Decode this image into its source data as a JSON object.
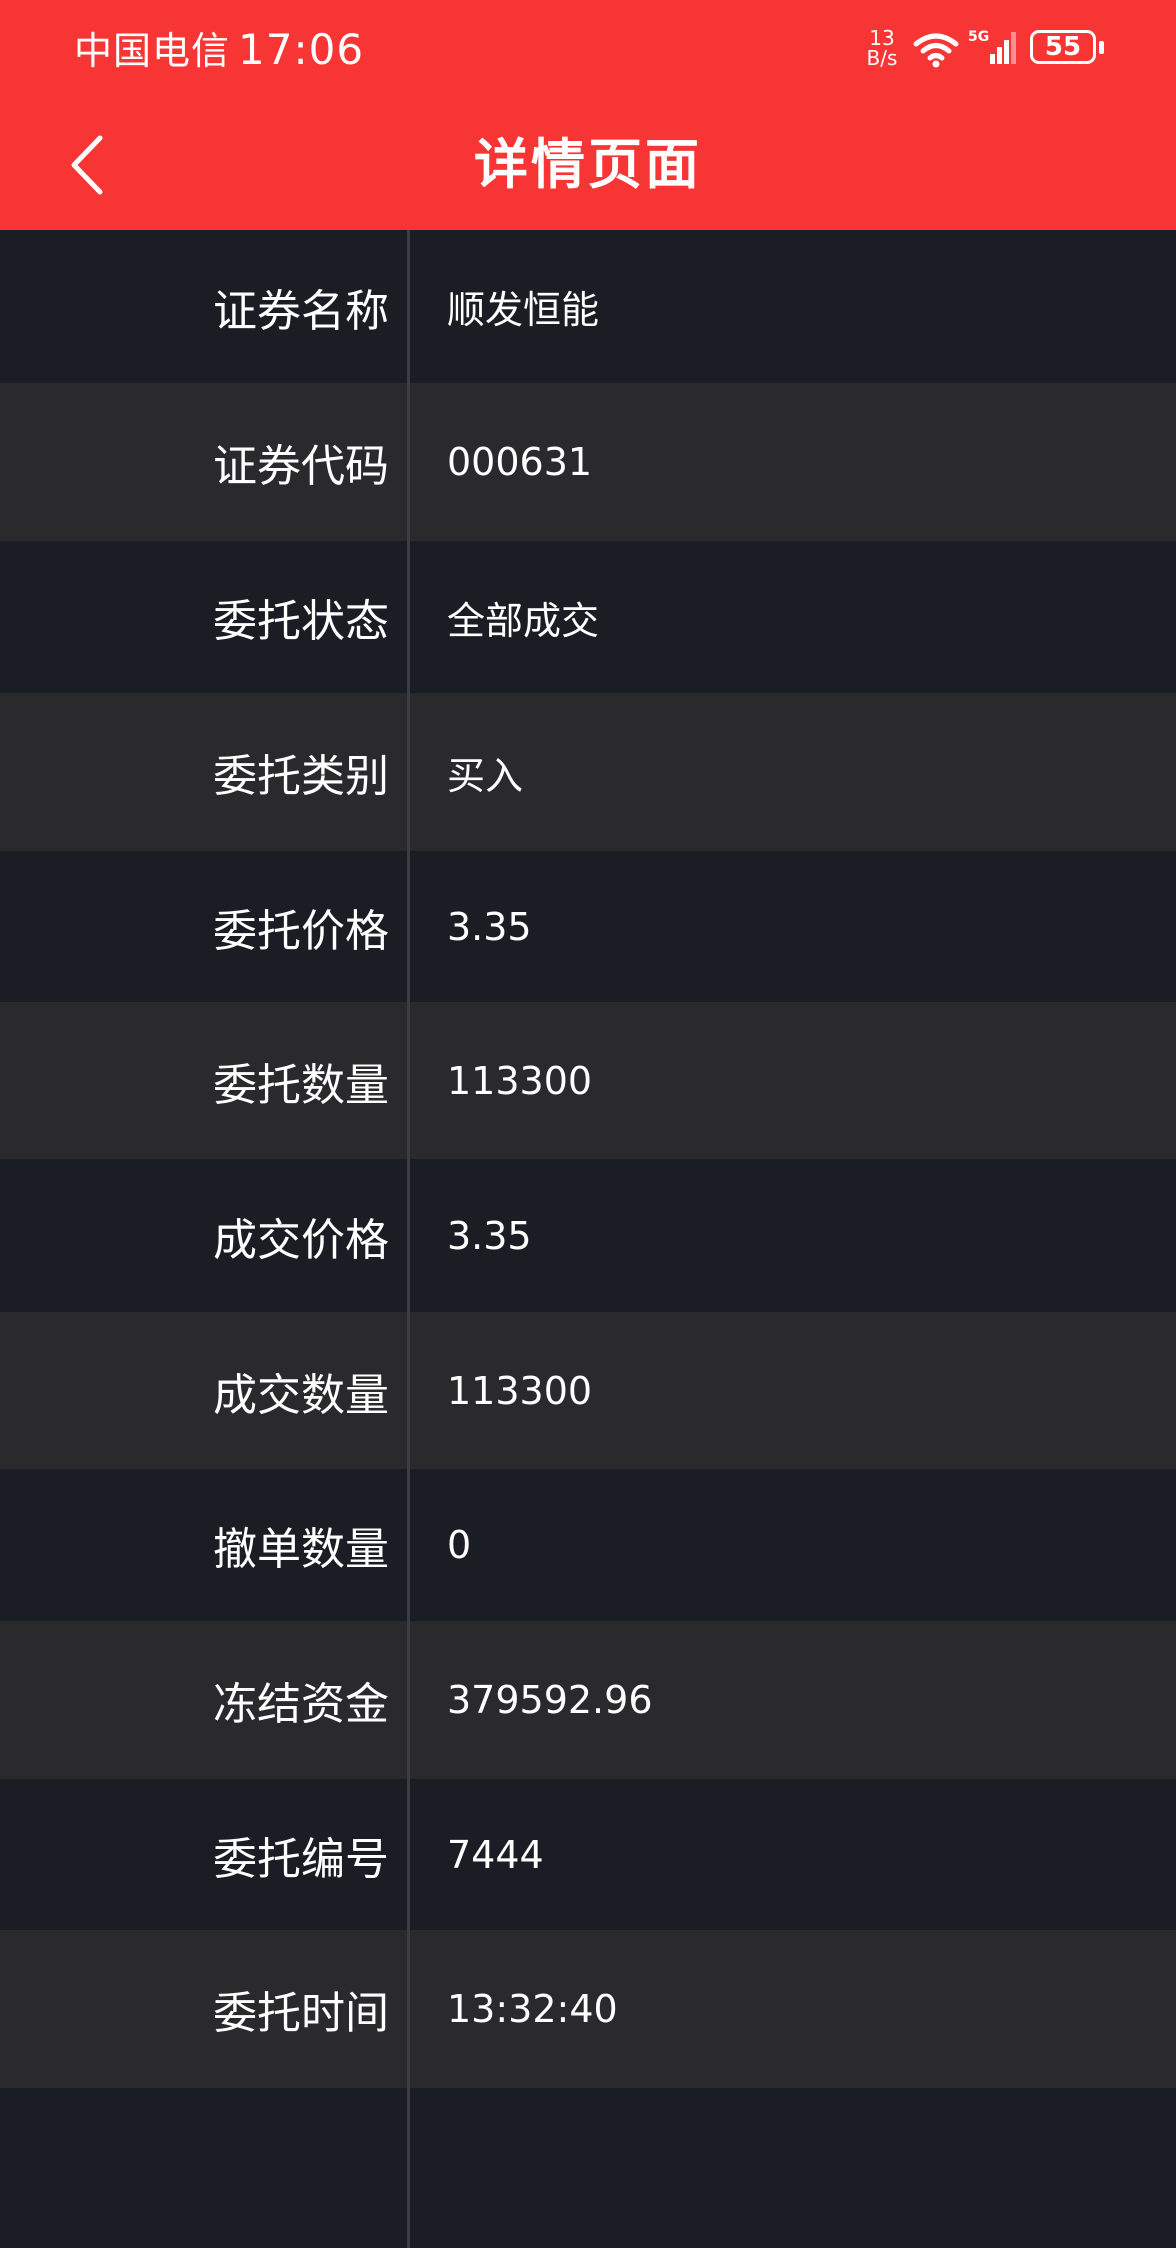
{
  "status_bar": {
    "carrier": "中国电信",
    "time": "17:06",
    "net_speed_value": "13",
    "net_speed_unit": "B/s",
    "network_type": "5G",
    "battery": "55"
  },
  "nav": {
    "title": "详情页面"
  },
  "rows": [
    {
      "label": "证券名称",
      "value": "顺发恒能"
    },
    {
      "label": "证券代码",
      "value": "000631"
    },
    {
      "label": "委托状态",
      "value": "全部成交"
    },
    {
      "label": "委托类别",
      "value": "买入"
    },
    {
      "label": "委托价格",
      "value": "3.35"
    },
    {
      "label": "委托数量",
      "value": "113300"
    },
    {
      "label": "成交价格",
      "value": "3.35"
    },
    {
      "label": "成交数量",
      "value": "113300"
    },
    {
      "label": "撤单数量",
      "value": "0"
    },
    {
      "label": "冻结资金",
      "value": "379592.96"
    },
    {
      "label": "委托编号",
      "value": "7444"
    },
    {
      "label": "委托时间",
      "value": "13:32:40"
    },
    {
      "label": "",
      "value": ""
    }
  ],
  "colors": {
    "header": "#f73535",
    "row_dark": "#1b1d24",
    "row_light": "#2a2a2c",
    "text": "#ffffff"
  }
}
